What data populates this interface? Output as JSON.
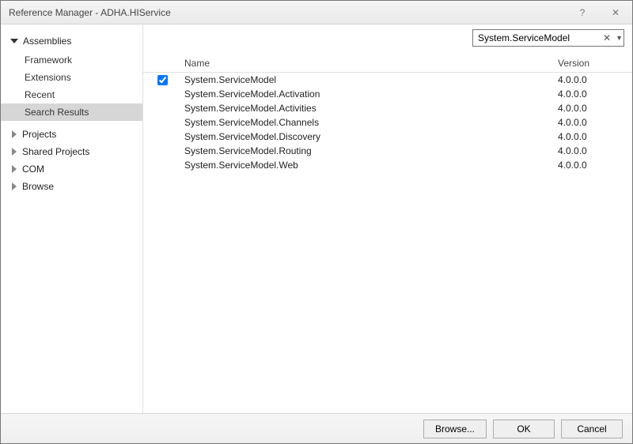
{
  "title": "Reference Manager - ADHA.HIService",
  "searchValue": "System.ServiceModel",
  "sidebar": {
    "categories": [
      {
        "label": "Assemblies",
        "expanded": true,
        "items": [
          {
            "label": "Framework"
          },
          {
            "label": "Extensions"
          },
          {
            "label": "Recent"
          },
          {
            "label": "Search Results",
            "active": true
          }
        ]
      },
      {
        "label": "Projects",
        "expanded": false
      },
      {
        "label": "Shared Projects",
        "expanded": false
      },
      {
        "label": "COM",
        "expanded": false
      },
      {
        "label": "Browse",
        "expanded": false
      }
    ]
  },
  "columns": {
    "name": "Name",
    "version": "Version"
  },
  "rows": [
    {
      "checked": true,
      "name": "System.ServiceModel",
      "version": "4.0.0.0"
    },
    {
      "checked": false,
      "name": "System.ServiceModel.Activation",
      "version": "4.0.0.0"
    },
    {
      "checked": false,
      "name": "System.ServiceModel.Activities",
      "version": "4.0.0.0"
    },
    {
      "checked": false,
      "name": "System.ServiceModel.Channels",
      "version": "4.0.0.0"
    },
    {
      "checked": false,
      "name": "System.ServiceModel.Discovery",
      "version": "4.0.0.0"
    },
    {
      "checked": false,
      "name": "System.ServiceModel.Routing",
      "version": "4.0.0.0"
    },
    {
      "checked": false,
      "name": "System.ServiceModel.Web",
      "version": "4.0.0.0"
    }
  ],
  "buttons": {
    "browse": "Browse...",
    "ok": "OK",
    "cancel": "Cancel"
  }
}
